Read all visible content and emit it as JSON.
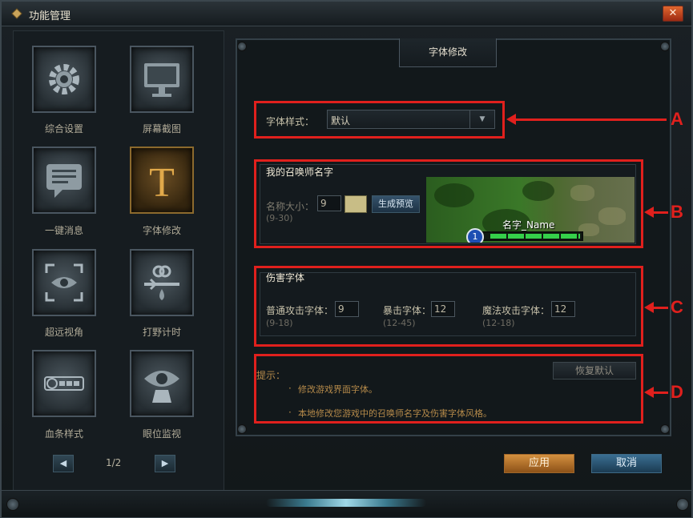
{
  "window": {
    "title": "功能管理",
    "close_label": "✕"
  },
  "sidebar": {
    "items": [
      {
        "label": "综合设置",
        "icon": "gear-icon"
      },
      {
        "label": "屏幕截图",
        "icon": "monitor-icon"
      },
      {
        "label": "一键消息",
        "icon": "chat-icon"
      },
      {
        "label": "字体修改",
        "icon": "font-t-icon"
      },
      {
        "label": "超远视角",
        "icon": "eye-focus-icon"
      },
      {
        "label": "打野计时",
        "icon": "timer-icon"
      },
      {
        "label": "血条样式",
        "icon": "healthbar-icon"
      },
      {
        "label": "眼位监视",
        "icon": "ward-eye-icon"
      }
    ],
    "pager": {
      "prev": "◀",
      "next": "▶",
      "text": "1/2"
    }
  },
  "panel": {
    "tab_title": "字体修改",
    "font_style": {
      "label": "字体样式：",
      "value": "默认"
    },
    "summoner": {
      "title": "我的召唤师名字",
      "size_label": "名称大小：",
      "size_value": "9",
      "size_range": "(9-30)",
      "preview_button": "生成预览",
      "preview_name": "名字_Name",
      "preview_level": "1",
      "color_swatch": "#c8bd86"
    },
    "damage": {
      "title": "伤害字体",
      "fields": [
        {
          "label": "普通攻击字体：",
          "value": "9",
          "range": "(9-18)"
        },
        {
          "label": "暴击字体：",
          "value": "12",
          "range": "(12-45)"
        },
        {
          "label": "魔法攻击字体：",
          "value": "12",
          "range": "(12-18)"
        }
      ]
    },
    "tips": {
      "title": "提示：",
      "reset_button": "恢复默认",
      "lines": [
        "修改游戏界面字体。",
        "本地修改您游戏中的召唤师名字及伤害字体风格。"
      ]
    }
  },
  "footer": {
    "apply": "应用",
    "cancel": "取消"
  },
  "annotations": {
    "letters": [
      "A",
      "B",
      "C",
      "D"
    ],
    "color": "#e0201d"
  }
}
